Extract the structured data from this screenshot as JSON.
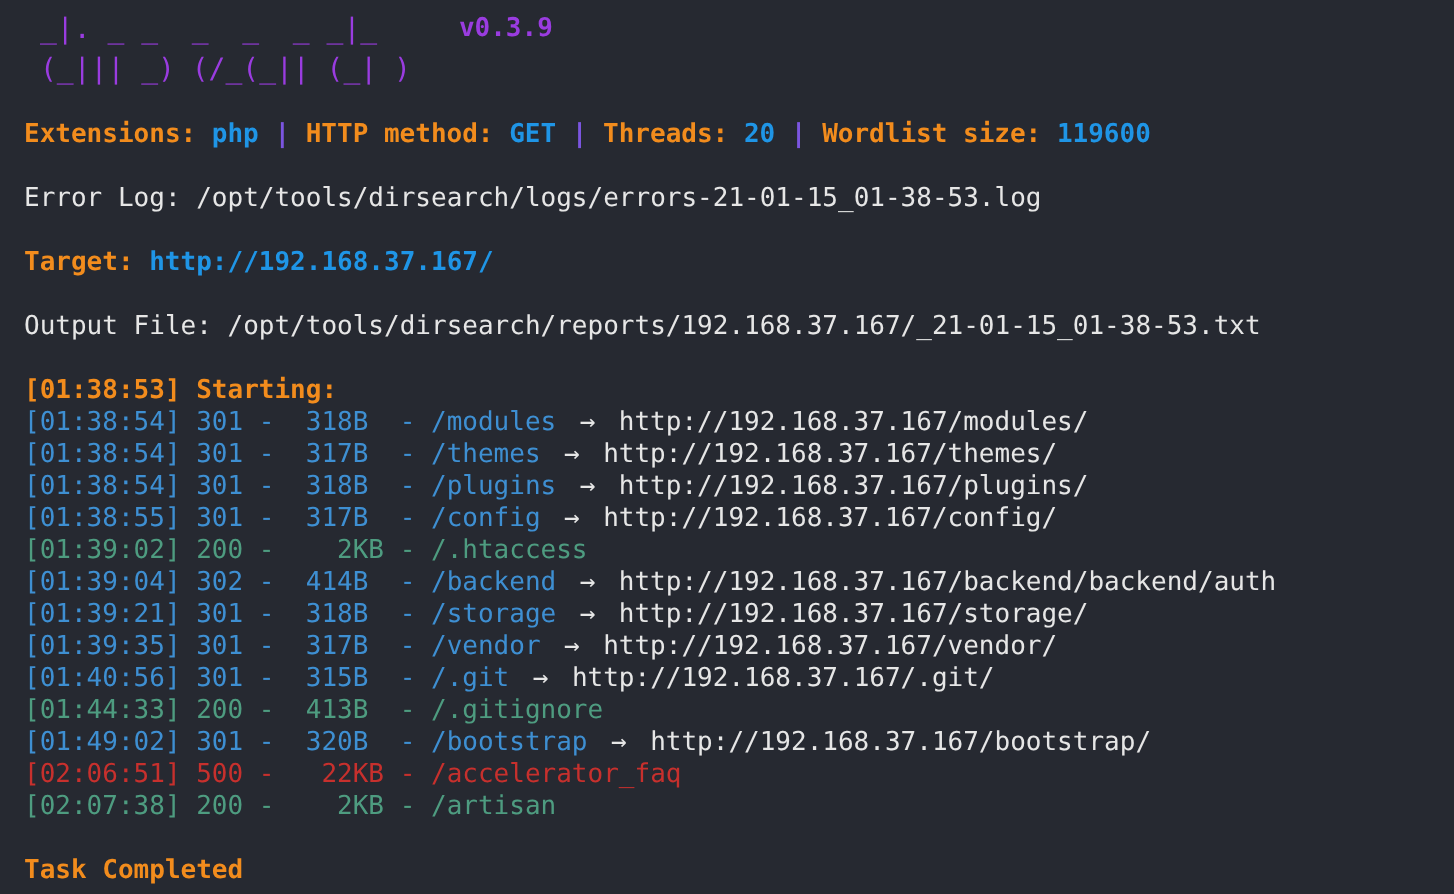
{
  "logo": {
    "lines": [
      "_|. _ _  _  _  _ _|_",
      "(_||| _) (/_(_|| (_| )"
    ],
    "version": "v0.3.9"
  },
  "settings": [
    {
      "label": "Extensions:",
      "value": "php",
      "separator": "|"
    },
    {
      "label": "HTTP method:",
      "value": "GET",
      "separator": "|"
    },
    {
      "label": "Threads:",
      "value": "20",
      "separator": "|"
    },
    {
      "label": "Wordlist size:",
      "value": "119600"
    }
  ],
  "error_log": "Error Log: /opt/tools/dirsearch/logs/errors-21-01-15_01-38-53.log",
  "target": {
    "label": "Target:",
    "value": "http://192.168.37.167/"
  },
  "output_file": "Output File: /opt/tools/dirsearch/reports/192.168.37.167/_21-01-15_01-38-53.txt",
  "start_line": "[01:38:53] Starting:",
  "results": [
    {
      "entry": "[01:38:54] 301 -  318B  - /modules",
      "color": "#3e8fd2",
      "arrow": "→",
      "redirect": "http://192.168.37.167/modules/"
    },
    {
      "entry": "[01:38:54] 301 -  317B  - /themes",
      "color": "#3e8fd2",
      "arrow": "→",
      "redirect": "http://192.168.37.167/themes/"
    },
    {
      "entry": "[01:38:54] 301 -  318B  - /plugins",
      "color": "#3e8fd2",
      "arrow": "→",
      "redirect": "http://192.168.37.167/plugins/"
    },
    {
      "entry": "[01:38:55] 301 -  317B  - /config",
      "color": "#3e8fd2",
      "arrow": "→",
      "redirect": "http://192.168.37.167/config/"
    },
    {
      "entry": "[01:39:02] 200 -    2KB - /.htaccess",
      "color": "#4e9c80"
    },
    {
      "entry": "[01:39:04] 302 -  414B  - /backend",
      "color": "#3e8fd2",
      "arrow": "→",
      "redirect": "http://192.168.37.167/backend/backend/auth"
    },
    {
      "entry": "[01:39:21] 301 -  318B  - /storage",
      "color": "#3e8fd2",
      "arrow": "→",
      "redirect": "http://192.168.37.167/storage/"
    },
    {
      "entry": "[01:39:35] 301 -  317B  - /vendor",
      "color": "#3e8fd2",
      "arrow": "→",
      "redirect": "http://192.168.37.167/vendor/"
    },
    {
      "entry": "[01:40:56] 301 -  315B  - /.git",
      "color": "#3e8fd2",
      "arrow": "→",
      "redirect": "http://192.168.37.167/.git/"
    },
    {
      "entry": "[01:44:33] 200 -  413B  - /.gitignore",
      "color": "#4e9c80"
    },
    {
      "entry": "[01:49:02] 301 -  320B  - /bootstrap",
      "color": "#3e8fd2",
      "arrow": "→",
      "redirect": "http://192.168.37.167/bootstrap/"
    },
    {
      "entry": "[02:06:51] 500 -   22KB - /accelerator_faq",
      "color": "#c7302d"
    },
    {
      "entry": "[02:07:38] 200 -    2KB - /artisan",
      "color": "#4e9c80"
    }
  ],
  "completion": "Task Completed"
}
